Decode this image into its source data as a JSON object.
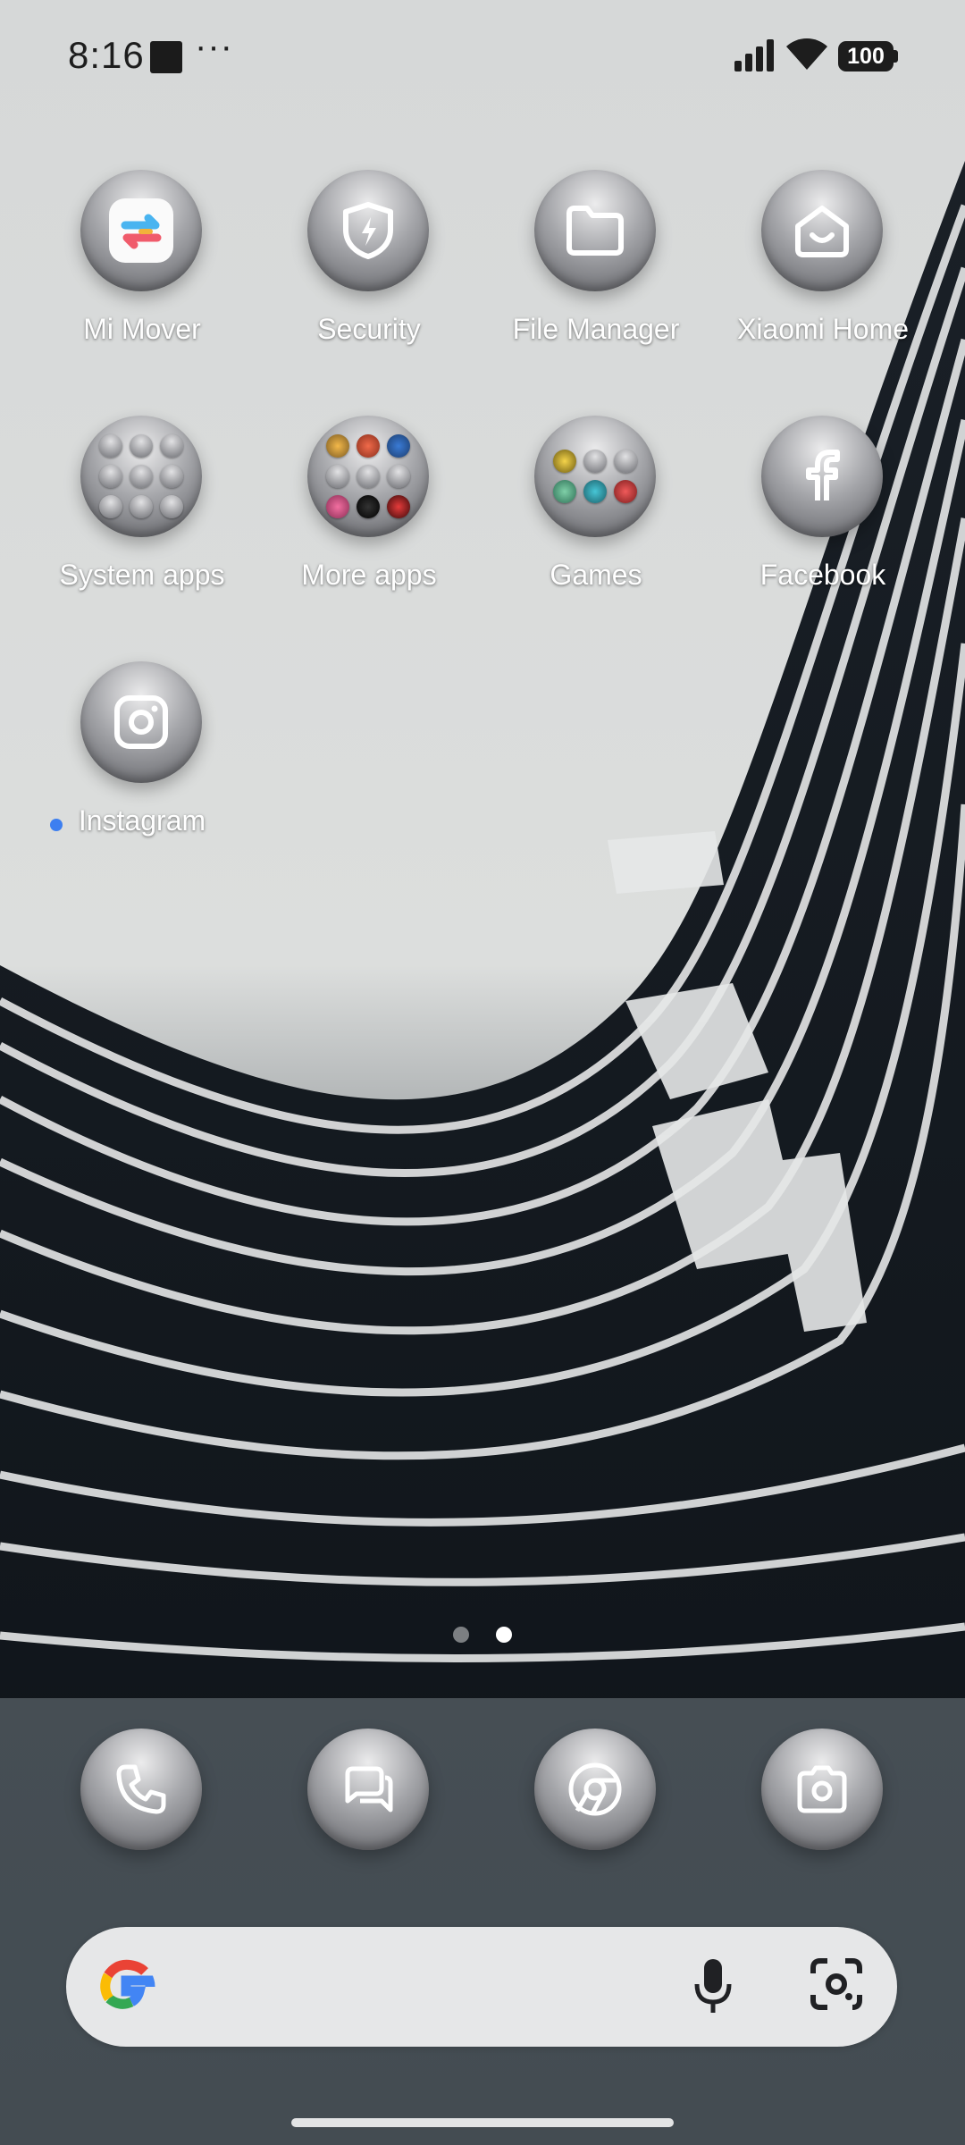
{
  "status_bar": {
    "time": "8:16",
    "more": "···",
    "battery": "100"
  },
  "home_apps": [
    {
      "label": "Mi Mover",
      "icon": "mi-mover-icon"
    },
    {
      "label": "Security",
      "icon": "shield-bolt-icon"
    },
    {
      "label": "File Manager",
      "icon": "folder-icon"
    },
    {
      "label": "Xiaomi Home",
      "icon": "smiling-house-icon"
    },
    {
      "label": "System apps",
      "icon": "folder-grid-icon"
    },
    {
      "label": "More apps",
      "icon": "folder-grid-icon"
    },
    {
      "label": "Games",
      "icon": "folder-grid-icon"
    },
    {
      "label": "Facebook",
      "icon": "facebook-icon"
    },
    {
      "label": "Instagram",
      "icon": "instagram-icon",
      "new_badge": true
    }
  ],
  "dock_apps": [
    {
      "name": "Phone",
      "icon": "phone-icon"
    },
    {
      "name": "Messages",
      "icon": "messages-icon"
    },
    {
      "name": "Chrome",
      "icon": "chrome-icon"
    },
    {
      "name": "Camera",
      "icon": "camera-icon"
    }
  ],
  "page_indicator": {
    "pages": 2,
    "current": 2
  },
  "search_bar": {
    "logo": "google-g-icon",
    "voice": "mic-icon",
    "lens": "google-lens-icon"
  },
  "colors": {
    "badge": "#3d7ff0",
    "label_text": "#ffffff"
  }
}
